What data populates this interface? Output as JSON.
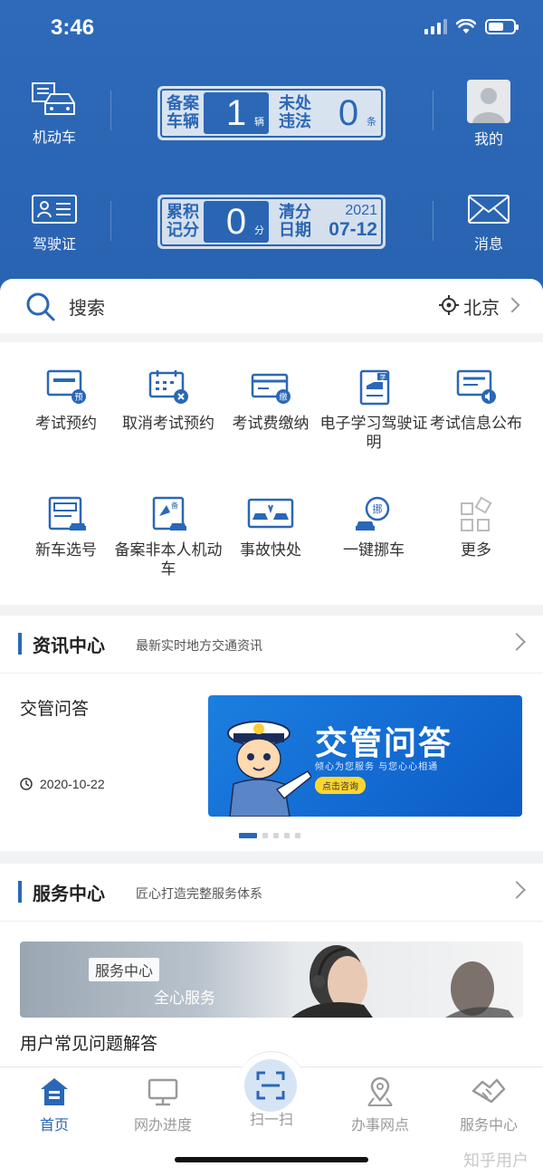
{
  "status": {
    "time": "3:46"
  },
  "header": {
    "vehicle_label": "机动车",
    "license_label": "驾驶证",
    "profile_label": "我的",
    "message_label": "消息",
    "plate1": {
      "registered_label": "备案车辆",
      "registered_count": "1",
      "registered_unit": "辆",
      "violation_label": "未处违法",
      "violation_count": "0",
      "violation_unit": "条"
    },
    "plate2": {
      "points_label": "累积记分",
      "points_value": "0",
      "points_unit": "分",
      "clear_label": "清分日期",
      "clear_year": "2021",
      "clear_date": "07-12"
    }
  },
  "search": {
    "placeholder": "搜索",
    "city": "北京"
  },
  "services": [
    {
      "label": "考试预约",
      "icon": "exam-booking-icon"
    },
    {
      "label": "取消考试预约",
      "icon": "cancel-exam-icon"
    },
    {
      "label": "考试费缴纳",
      "icon": "exam-fee-icon"
    },
    {
      "label": "电子学习驾驶证明",
      "icon": "e-learning-icon"
    },
    {
      "label": "考试信息公布",
      "icon": "exam-info-icon"
    },
    {
      "label": "新车选号",
      "icon": "new-plate-icon"
    },
    {
      "label": "备案非本人机动车",
      "icon": "register-vehicle-icon"
    },
    {
      "label": "事故快处",
      "icon": "accident-icon"
    },
    {
      "label": "一键挪车",
      "icon": "move-car-icon"
    },
    {
      "label": "更多",
      "icon": "more-icon"
    }
  ],
  "news": {
    "title": "资讯中心",
    "subtitle": "最新实时地方交通资讯",
    "item_title": "交管问答",
    "item_date": "2020-10-22",
    "banner_title": "交管问答",
    "banner_sub": "倾心为您服务    与您心心相通",
    "banner_button": "点击咨询"
  },
  "service_center": {
    "title": "服务中心",
    "subtitle": "匠心打造完整服务体系",
    "banner_tag": "服务中心",
    "banner_text": "全心服务",
    "faq_title": "用户常见问题解答"
  },
  "tabs": [
    {
      "label": "首页",
      "active": true
    },
    {
      "label": "网办进度"
    },
    {
      "label": "扫一扫"
    },
    {
      "label": "办事网点"
    },
    {
      "label": "服务中心"
    }
  ],
  "watermark": "知乎用户",
  "colors": {
    "primary": "#2a67b8",
    "accent_yellow": "#ffd630"
  }
}
